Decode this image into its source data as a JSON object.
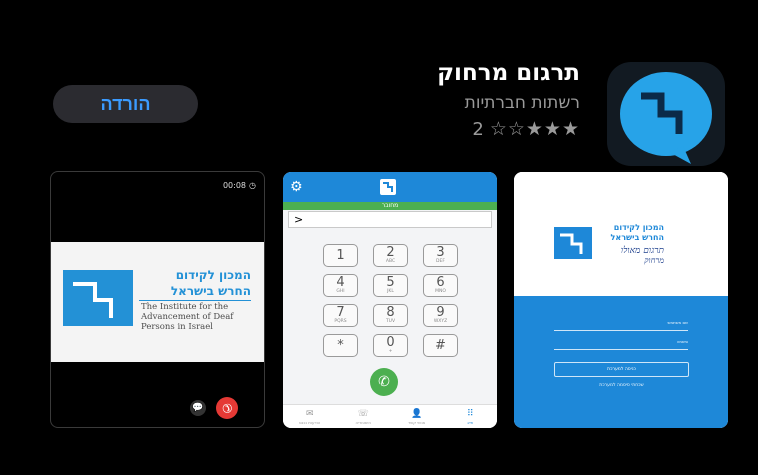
{
  "app": {
    "title": "תרגום מרחוק",
    "category": "רשתות חברתיות",
    "rating_stars": "★★★☆☆",
    "rating_count": "2",
    "get_button_label": "הורדה",
    "accent_color": "#3b9bff",
    "icon": "speech-bubble-logo-icon"
  },
  "screenshot_video_call": {
    "timer": "00:08",
    "org_name_line1": "המכון לקידום",
    "org_name_line2": "החרש בישראל",
    "org_name_english": "The Institute for the Advancement of Deaf Persons in Israel",
    "end_call_color": "#e53935"
  },
  "screenshot_dialpad": {
    "status": "מחובר",
    "input_prompt": ">",
    "keys": [
      {
        "n": "1",
        "l": ""
      },
      {
        "n": "2",
        "l": "ABC"
      },
      {
        "n": "3",
        "l": "DEF"
      },
      {
        "n": "4",
        "l": "GHI"
      },
      {
        "n": "5",
        "l": "JKL"
      },
      {
        "n": "6",
        "l": "MNO"
      },
      {
        "n": "7",
        "l": "PQRS"
      },
      {
        "n": "8",
        "l": "TUV"
      },
      {
        "n": "9",
        "l": "WXYZ"
      },
      {
        "n": "*",
        "l": ""
      },
      {
        "n": "0",
        "l": "+"
      },
      {
        "n": "#",
        "l": ""
      }
    ],
    "tabs": [
      {
        "icon": "mail-icon",
        "label": "הודעות נכנס"
      },
      {
        "icon": "call-history-icon",
        "label": "היסטוריה"
      },
      {
        "icon": "contacts-icon",
        "label": "אנשי קשר"
      },
      {
        "icon": "dialpad-icon",
        "label": "חייג"
      }
    ],
    "brand_color": "#1e88d8",
    "connected_color": "#4caf50"
  },
  "screenshot_login": {
    "org_line1": "המכון לקידום",
    "org_line2": "החרש בישראל",
    "service_line1": "תרגום מאולו",
    "service_line2": "מרחוק",
    "username_label": "שם משתמש",
    "password_label": "סיסמה",
    "login_button": "כניסה למערכת",
    "forgot_link": "שכחתי סיסמה למערכת"
  }
}
